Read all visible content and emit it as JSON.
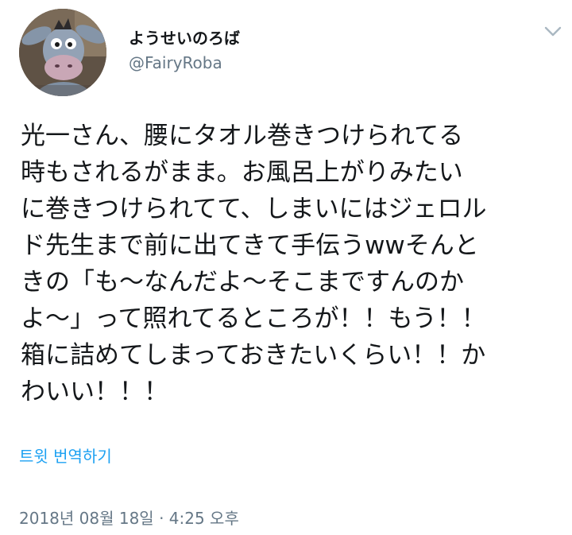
{
  "user": {
    "display_name": "ようせいのろば",
    "handle": "@FairyRoba",
    "avatar_icon": "eeyore-avatar-icon"
  },
  "header": {
    "more_icon": "chevron-down-icon"
  },
  "tweet": {
    "text": "光一さん、腰にタオル巻きつけられてる\n時もされるがまま。お風呂上がりみたい\nに巻きつけられてて、しまいにはジェロル\nド先生まで前に出てきて手伝うwwそんと\nきの「も〜なんだよ〜そこまですんのか\nよ〜」って照れてるところが！！もう！！\n箱に詰めてしまっておきたいくらい！！か\nわいい！！！",
    "translate_label": "트윗 번역하기",
    "timestamp": "2018년 08월 18일 · 4:25 오후"
  },
  "colors": {
    "text": "#14171a",
    "secondary": "#657786",
    "link": "#1da1f2",
    "background": "#ffffff"
  }
}
